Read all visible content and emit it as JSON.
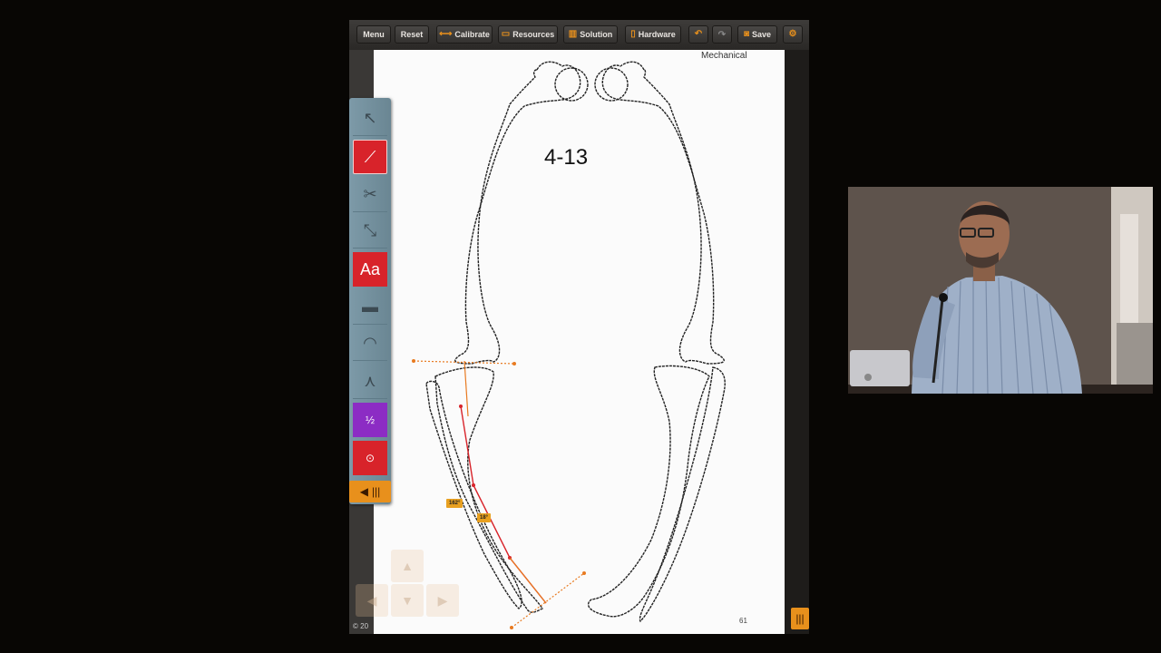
{
  "toolbar": {
    "menu": "Menu",
    "reset": "Reset",
    "calibrate": "Calibrate",
    "resources": "Resources",
    "solution": "Solution",
    "hardware": "Hardware",
    "save": "Save",
    "icons": {
      "calibrate": "calibrate-icon",
      "resources": "folder-icon",
      "solution": "book-icon",
      "hardware": "hardware-icon",
      "undo": "undo-icon",
      "redo": "redo-icon",
      "save": "camera-icon",
      "settings": "gear-icon"
    },
    "accent_color": "#e8901c"
  },
  "palette": {
    "tools": [
      {
        "name": "select-tool",
        "icon": "pointer-move-icon",
        "label": ""
      },
      {
        "name": "line-tool",
        "icon": "line-icon",
        "label": "",
        "active": true
      },
      {
        "name": "cut-tool",
        "icon": "scissors-icon",
        "label": ""
      },
      {
        "name": "move-fragment-tool",
        "icon": "move-fragment-icon",
        "label": ""
      },
      {
        "name": "text-tool",
        "icon": "text-icon",
        "label": "Aa"
      },
      {
        "name": "ruler-tool",
        "icon": "ruler-icon",
        "label": ""
      },
      {
        "name": "protractor-tool",
        "icon": "protractor-icon",
        "label": ""
      },
      {
        "name": "joint-tool",
        "icon": "joint-icon",
        "label": ""
      },
      {
        "name": "midpoint-tool",
        "icon": "midpoint-icon",
        "label": "½"
      },
      {
        "name": "circle-tool",
        "icon": "circle-icon",
        "label": ""
      }
    ],
    "colors": {
      "red": "#d8232a",
      "purple": "#8c2cc4",
      "palette_bg": "#7d9aa8"
    }
  },
  "canvas": {
    "case_title": "4-13",
    "section_label": "Mechanical",
    "page_number": "61",
    "angle_labels": [
      "162°",
      "18°"
    ],
    "line_color_orange": "#e87a20",
    "line_color_red": "#d8232a"
  },
  "footer": {
    "copyright": "© 20"
  }
}
